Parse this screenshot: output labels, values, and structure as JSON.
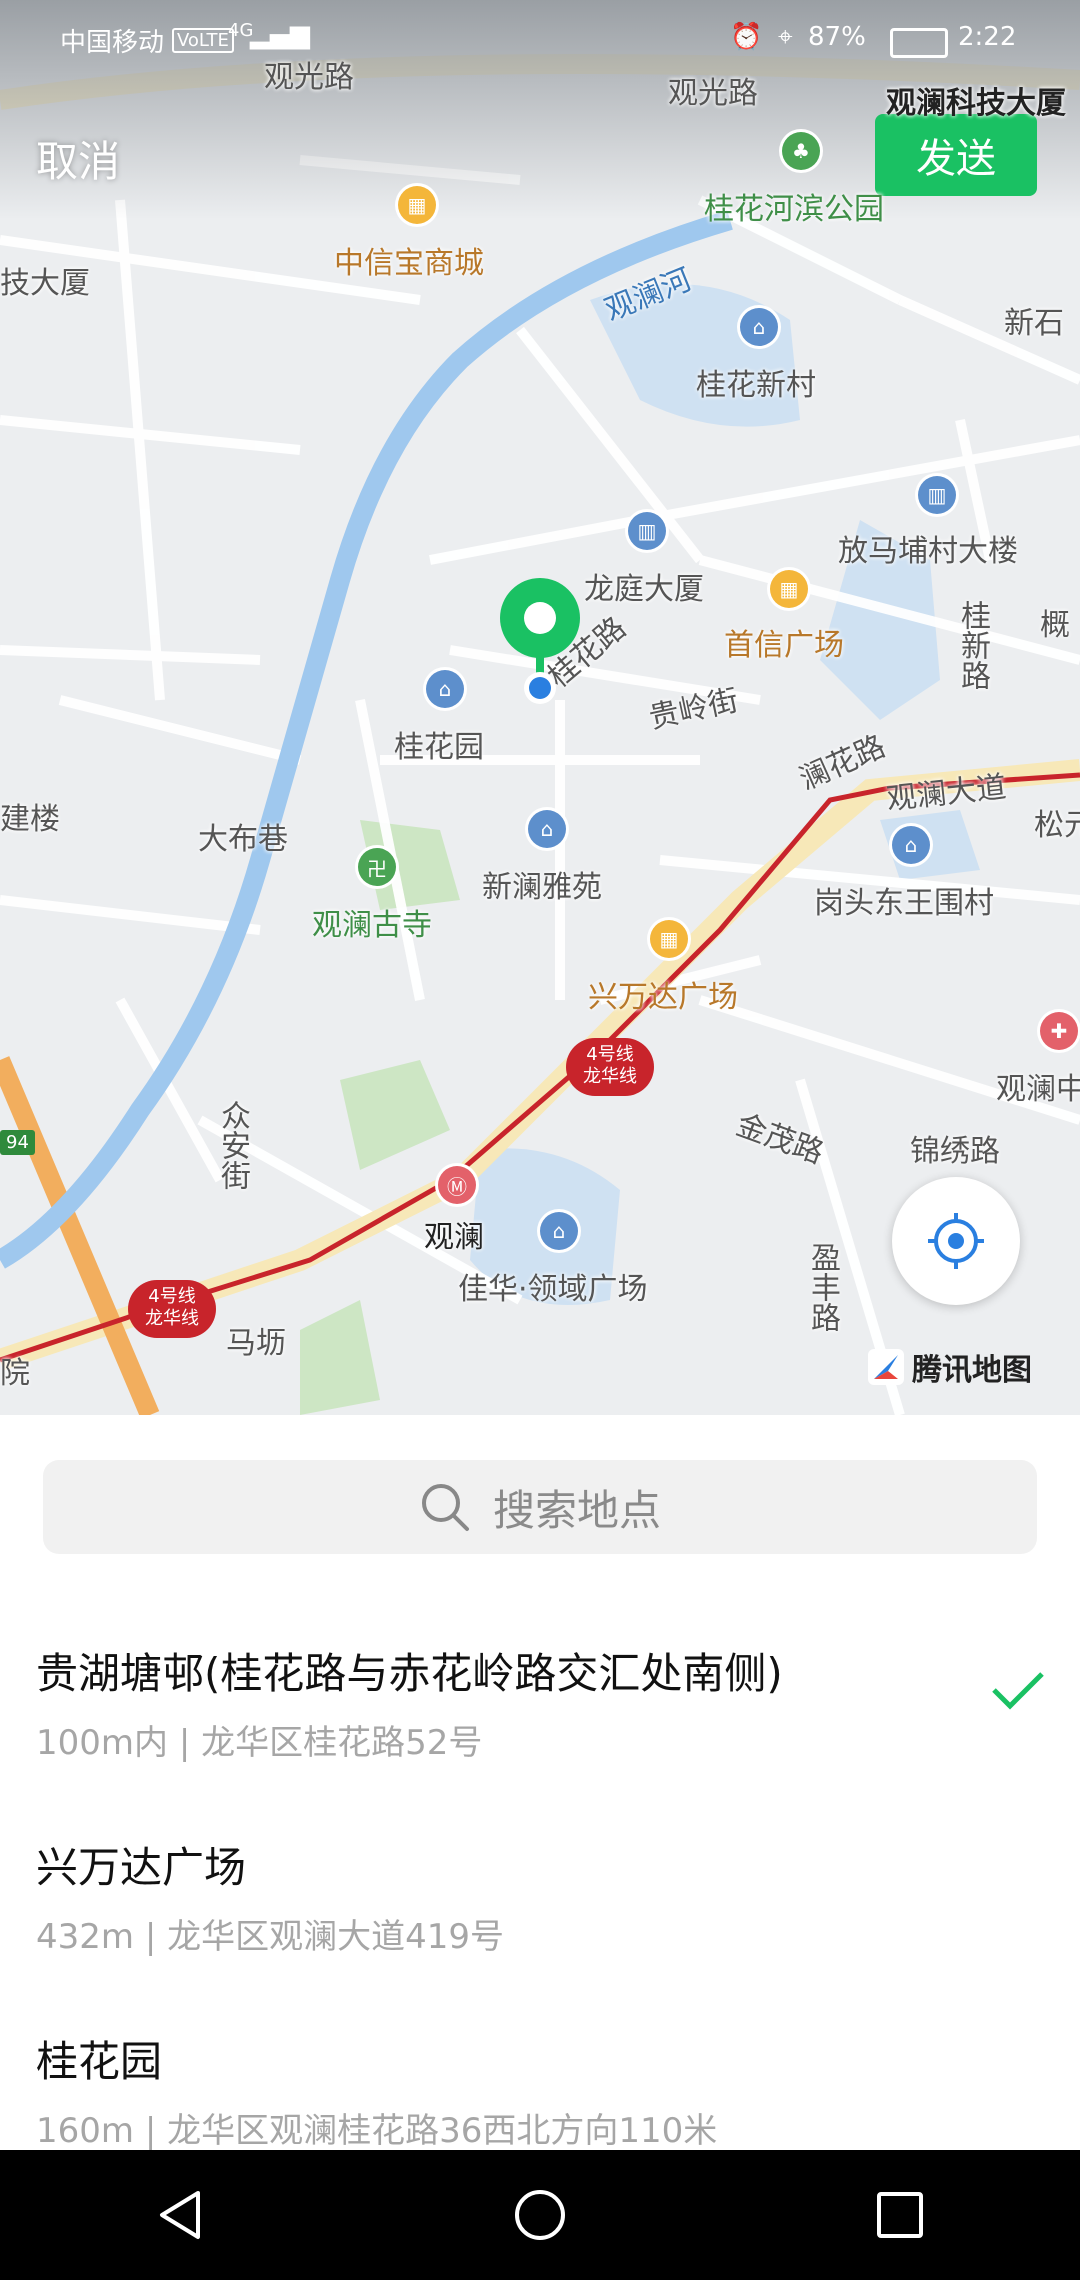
{
  "status": {
    "carrier": "中国移动",
    "volte": "VoLTE",
    "network": "4G",
    "battery": "87%",
    "time": "2:22"
  },
  "header": {
    "cancel": "取消",
    "send": "发送"
  },
  "map": {
    "labels": {
      "guanguang_road_1": "观光路",
      "guanguang_road_2": "观光路",
      "guanlan_tech": "观澜科技大厦",
      "guihua_park": "桂花河滨公园",
      "zhongxin_mall": "中信宝商城",
      "tech_left": "技大厦",
      "guanlan_river": "观澜河",
      "guihua_village": "桂花新村",
      "xinshi": "新石",
      "fangmabu": "放马埔村大楼",
      "longting": "龙庭大厦",
      "guihua_road": "桂花路",
      "shouxin": "首信广场",
      "gai": "概",
      "guiling_st": "贵岭街",
      "guihua_garden": "桂花园",
      "guixin_road": "桂新路",
      "lanhua_road": "澜花路",
      "guanlan_ave": "观澜大道",
      "song": "松元",
      "jian": "建楼",
      "dabu": "大布巷",
      "xinlan": "新澜雅苑",
      "gangtou": "岗头东王围村",
      "guanlan_temple": "观澜古寺",
      "xingwanda": "兴万达广场",
      "guanlan_mid": "观澜中",
      "line4_a": "4号线",
      "line4_b": "龙华线",
      "jinmao": "金茂路",
      "jinxiu": "锦绣路",
      "zhongan": "众安街",
      "guanlan_station": "观澜",
      "yingfeng": "盈丰路",
      "jiahua": "佳华·领域广场",
      "line4_c": "4号线",
      "line4_d": "龙华线",
      "mafang": "马坜",
      "yuan": "院",
      "road_94": "94"
    },
    "brand": "腾讯地图"
  },
  "search": {
    "placeholder": "搜索地点"
  },
  "places": [
    {
      "name": "贵湖塘邨(桂花路与赤花岭路交汇处南侧)",
      "detail": "100m内 | 龙华区桂花路52号",
      "selected": true
    },
    {
      "name": "兴万达广场",
      "detail": "432m | 龙华区观澜大道419号",
      "selected": false
    },
    {
      "name": "桂花园",
      "detail": "160m | 龙华区观澜桂花路36西北方向110米",
      "selected": false
    }
  ],
  "colors": {
    "accent": "#1ac163",
    "river": "#9fc8ee",
    "metro": "#c8242b",
    "road_major": "#f6e7b7"
  }
}
